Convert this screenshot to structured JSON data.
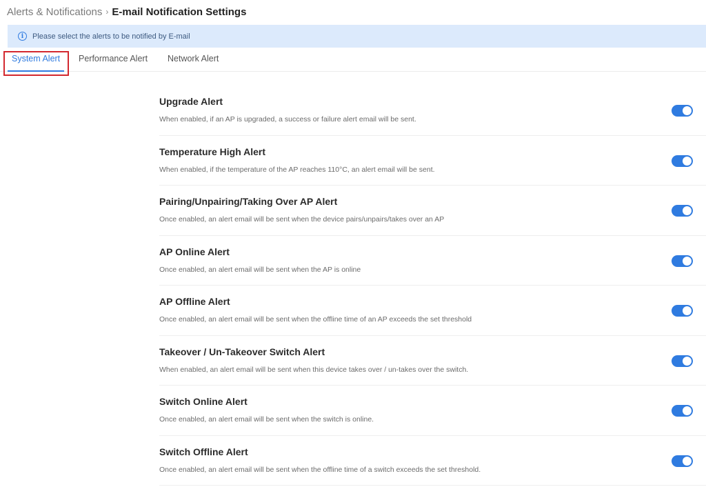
{
  "breadcrumb": {
    "parent": "Alerts & Notifications",
    "separator": "›",
    "current": "E-mail Notification Settings"
  },
  "info_banner": {
    "icon": "info-icon",
    "text": "Please select the alerts to be notified by E-mail"
  },
  "tabs": [
    {
      "label": "System Alert",
      "active": true
    },
    {
      "label": "Performance Alert",
      "active": false
    },
    {
      "label": "Network Alert",
      "active": false
    }
  ],
  "accent_color": "#2f7be0",
  "highlight_color": "#d3272e",
  "alerts": [
    {
      "title": "Upgrade Alert",
      "description": "When enabled, if an AP is upgraded, a success or failure alert email will be sent.",
      "enabled": true
    },
    {
      "title": "Temperature High Alert",
      "description": "When enabled, if the temperature of the AP reaches 110°C, an alert email will be sent.",
      "enabled": true
    },
    {
      "title": "Pairing/Unpairing/Taking Over AP Alert",
      "description": "Once enabled, an alert email will be sent when the device pairs/unpairs/takes over an AP",
      "enabled": true
    },
    {
      "title": "AP Online Alert",
      "description": "Once enabled, an alert email will be sent when the AP is online",
      "enabled": true
    },
    {
      "title": "AP Offline Alert",
      "description": "Once enabled, an alert email will be sent when the offline time of an AP exceeds the set threshold",
      "enabled": true
    },
    {
      "title": "Takeover / Un-Takeover Switch Alert",
      "description": "When enabled, an alert email will be sent when this device takes over / un-takes over the switch.",
      "enabled": true
    },
    {
      "title": "Switch Online Alert",
      "description": "Once enabled, an alert email will be sent when the switch is online.",
      "enabled": true
    },
    {
      "title": "Switch Offline Alert",
      "description": "Once enabled, an alert email will be sent when the offline time of a switch exceeds the set threshold.",
      "enabled": true
    }
  ]
}
